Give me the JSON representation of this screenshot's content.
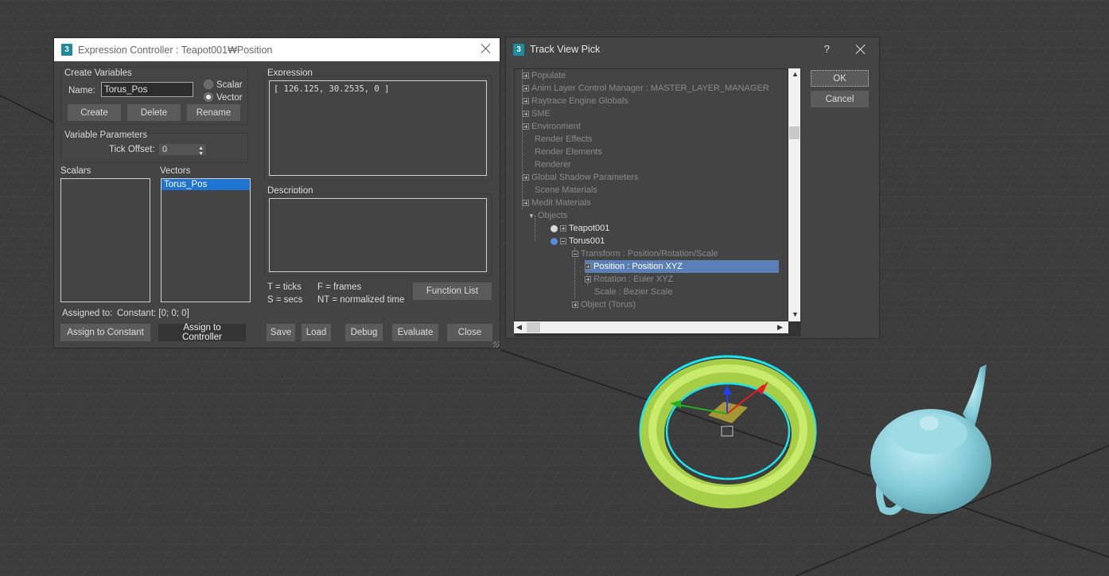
{
  "expression_controller": {
    "title": "Expression Controller : Teapot001₩Position",
    "create_variables": {
      "group_label": "Create Variables",
      "name_label": "Name:",
      "name_value": "Torus_Pos",
      "scalar_label": "Scalar",
      "vector_label": "Vector",
      "selected_type": "Vector",
      "create_button": "Create",
      "delete_button": "Delete",
      "rename_button": "Rename"
    },
    "variable_parameters": {
      "group_label": "Variable Parameters",
      "tick_offset_label": "Tick Offset:",
      "tick_offset_value": "0"
    },
    "scalars": {
      "label": "Scalars",
      "items": []
    },
    "vectors": {
      "label": "Vectors",
      "items": [
        "Torus_Pos"
      ],
      "selected": "Torus_Pos"
    },
    "expression": {
      "label": "Expression",
      "value": "[ 126.125, 30.2535, 0 ]"
    },
    "description": {
      "label": "Description",
      "value": ""
    },
    "legend": {
      "t": "T = ticks",
      "f": "F = frames",
      "s": "S = secs",
      "nt": "NT = normalized time"
    },
    "function_list_button": "Function List",
    "assigned_to_label": "Assigned to:",
    "assigned_to_value": "Constant: [0; 0; 0]",
    "buttons": {
      "assign_constant": "Assign to Constant",
      "assign_controller": "Assign to Controller",
      "save": "Save",
      "load": "Load",
      "debug": "Debug",
      "evaluate": "Evaluate",
      "close": "Close"
    }
  },
  "track_view_pick": {
    "title": "Track View Pick",
    "help": "?",
    "ok_button": "OK",
    "cancel_button": "Cancel",
    "tree": [
      "Populate",
      "Anim Layer Control Manager : MASTER_LAYER_MANAGER",
      "Raytrace Engine Globals",
      "SME",
      "Environment",
      "Render Effects",
      "Render Elements",
      "Renderer",
      "Global Shadow Parameters",
      "Scene Materials",
      "Medit Materials",
      "Objects",
      "Teapot001",
      "Torus001",
      "Transform : Position/Rotation/Scale",
      "Position : Position XYZ",
      "Rotation : Euler XYZ",
      "Scale : Bezier Scale",
      "Object (Torus)"
    ],
    "selected_item": "Position : Position XYZ"
  },
  "colors": {
    "viewport_bg": "#3d3d3d",
    "selection_blue": "#1e74d0",
    "tree_selection": "#5b80b8",
    "torus": "#b4dc50",
    "teapot": "#8ed4e0",
    "selection_outline": "#19e6f0"
  }
}
